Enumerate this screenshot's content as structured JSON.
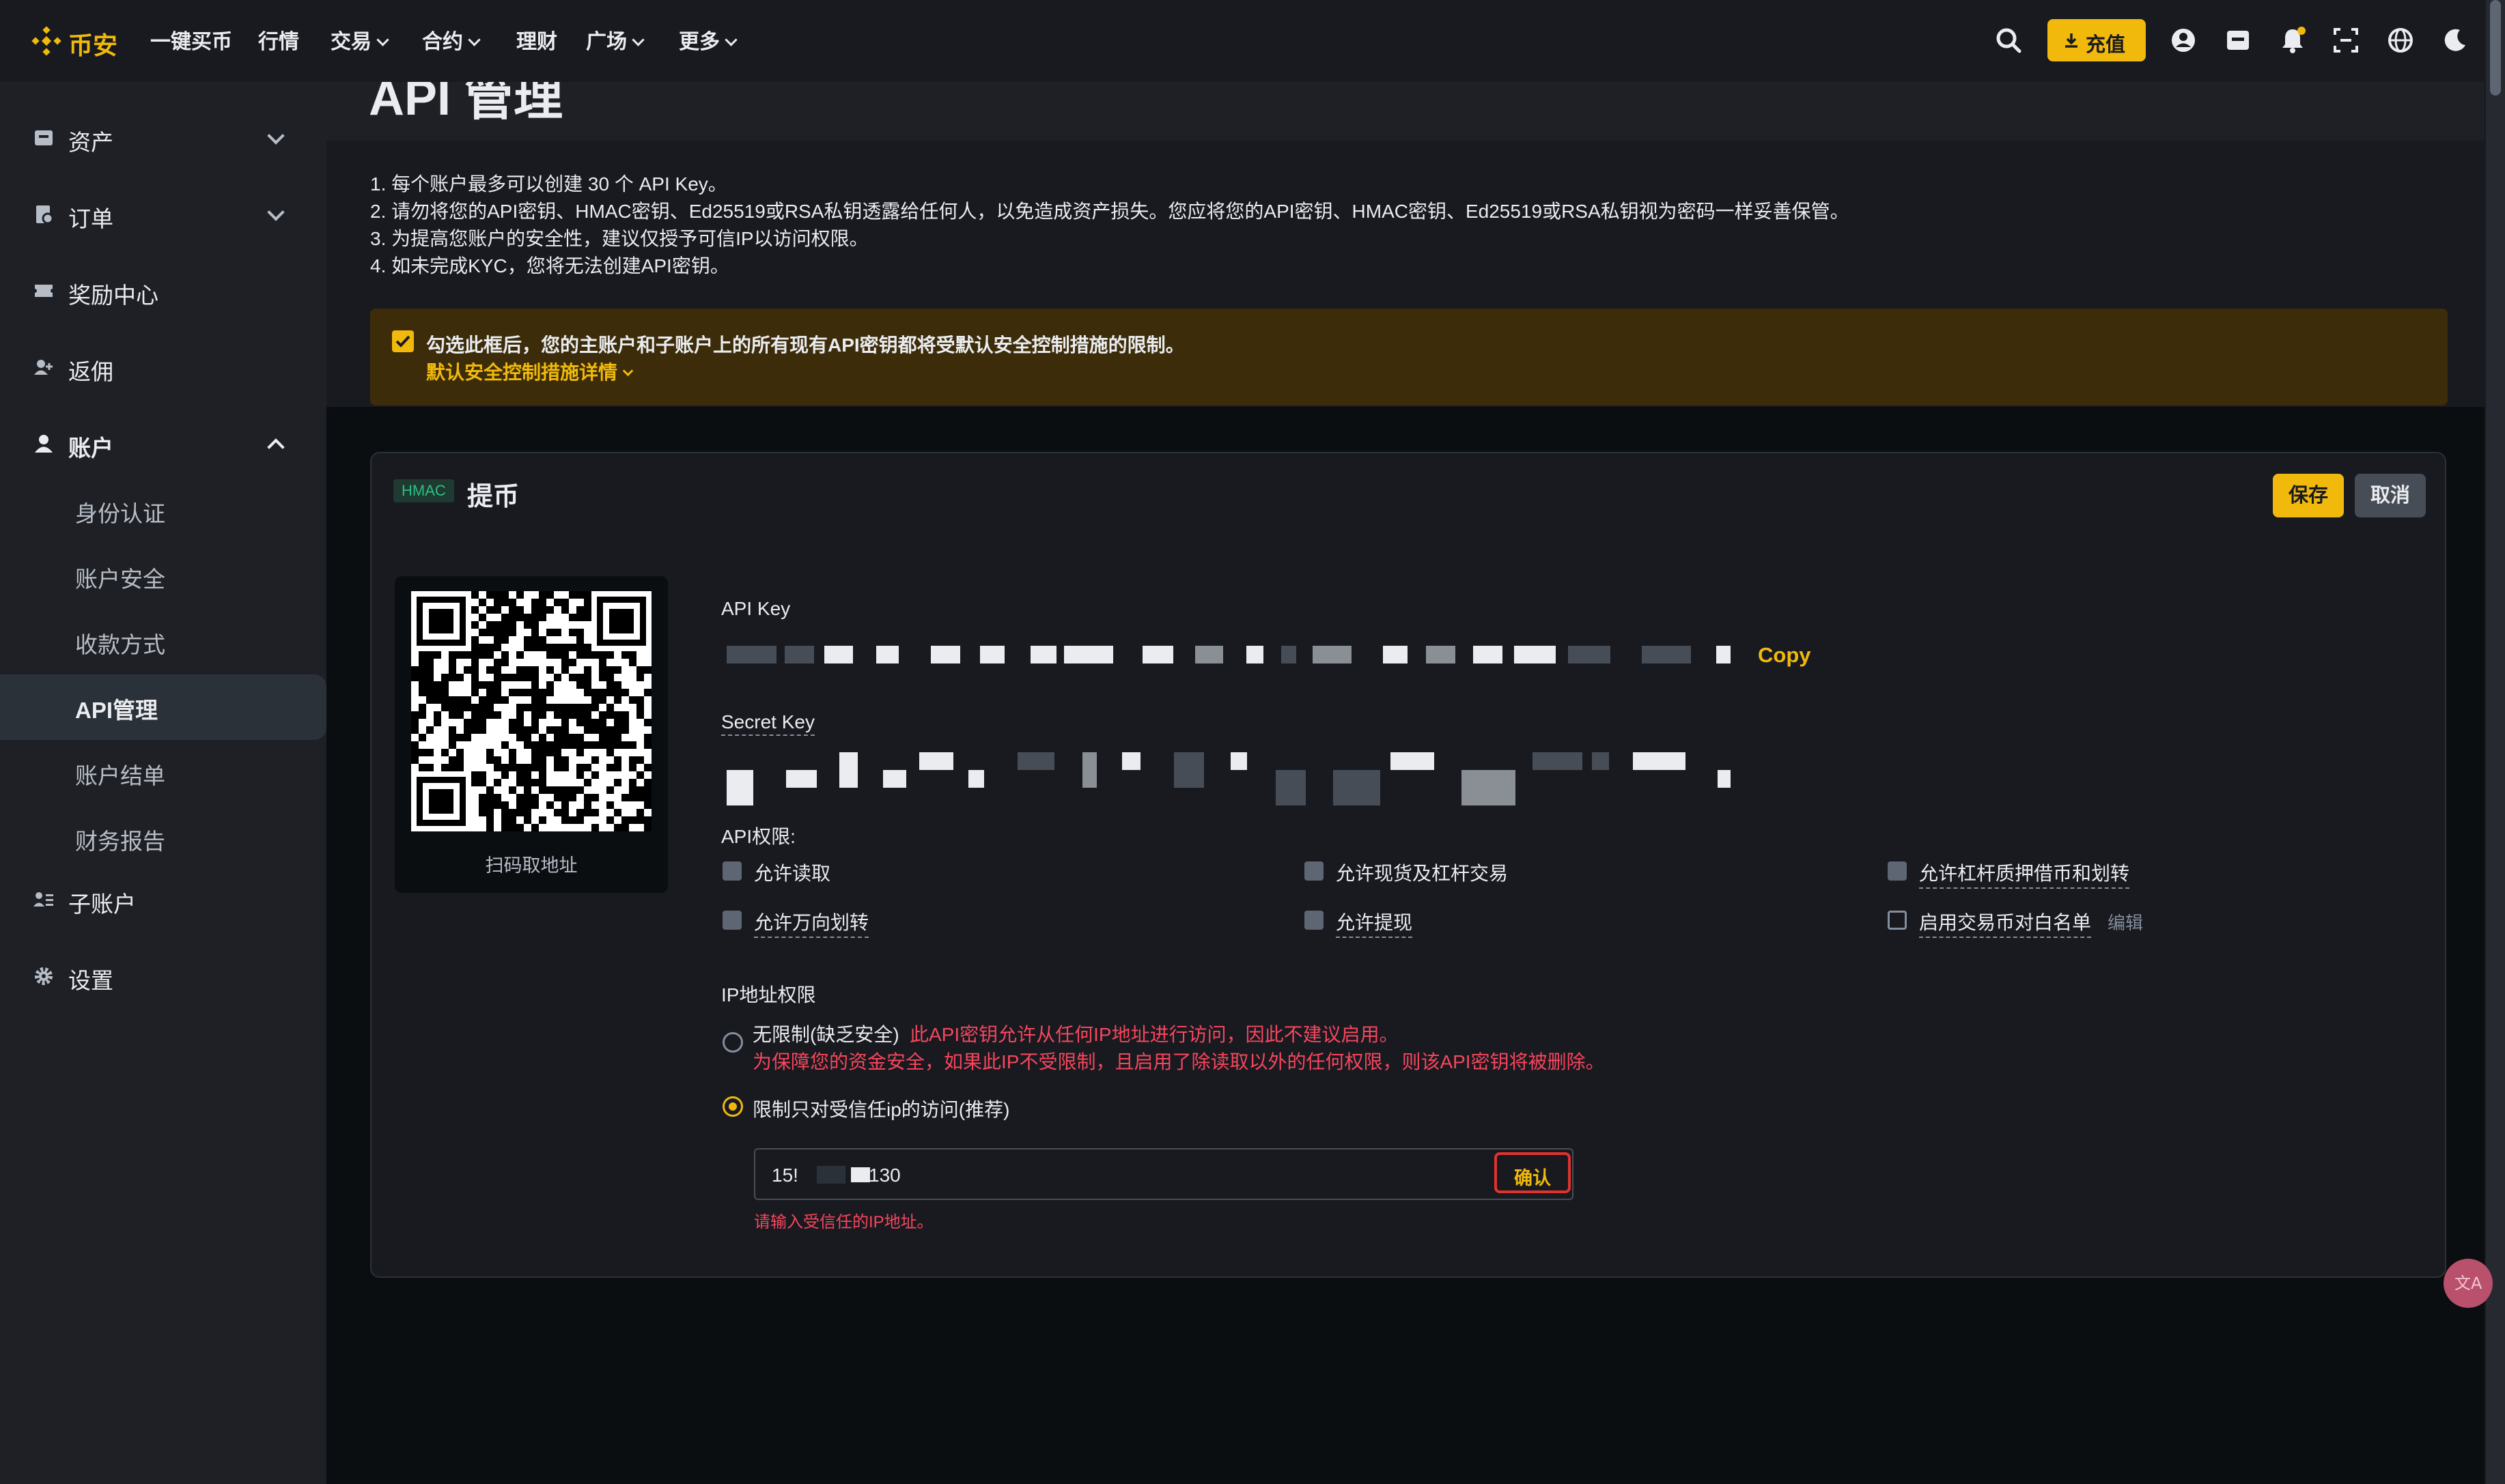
{
  "brand": {
    "name": "币安",
    "accent": "#f0b90b"
  },
  "topnav": {
    "links": [
      "一键买币",
      "行情",
      "交易",
      "合约",
      "理财",
      "广场",
      "更多"
    ],
    "deposit_label": "充值"
  },
  "sidebar": {
    "items": [
      {
        "label": "资产",
        "icon": "wallet-icon"
      },
      {
        "label": "订单",
        "icon": "order-icon"
      },
      {
        "label": "奖励中心",
        "icon": "ticket-icon"
      },
      {
        "label": "返佣",
        "icon": "referral-icon"
      },
      {
        "label": "账户",
        "icon": "user-icon"
      }
    ],
    "account_subitems": [
      "身份认证",
      "账户安全",
      "收款方式",
      "API管理",
      "账户结单",
      "财务报告"
    ],
    "bottom_items": [
      {
        "label": "子账户",
        "icon": "sub-account-icon"
      },
      {
        "label": "设置",
        "icon": "gear-icon"
      }
    ]
  },
  "page": {
    "title": "API 管理",
    "notes": [
      "1. 每个账户最多可以创建 30 个 API Key。",
      "2. 请勿将您的API密钥、HMAC密钥、Ed25519或RSA私钥透露给任何人，以免造成资产损失。您应将您的API密钥、HMAC密钥、Ed25519或RSA私钥视为密码一样妥善保管。",
      "3. 为提高您账户的安全性，建议仅授予可信IP以访问权限。",
      "4. 如未完成KYC，您将无法创建API密钥。"
    ],
    "banner": {
      "text": "勾选此框后，您的主账户和子账户上的所有现有API密钥都将受默认安全控制措施的限制。",
      "link": "默认安全控制措施详情"
    }
  },
  "card": {
    "badge": "HMAC",
    "name": "提币",
    "save_label": "保存",
    "cancel_label": "取消",
    "qr_caption": "扫码取地址",
    "api_key_label": "API Key",
    "copy_label": "Copy",
    "secret_key_label": "Secret Key",
    "permissions_label": "API权限:",
    "permissions": [
      {
        "label": "允许读取",
        "checked": true
      },
      {
        "label": "允许现货及杠杆交易",
        "checked": false
      },
      {
        "label": "允许杠杆质押借币和划转",
        "checked": false
      },
      {
        "label": "允许万向划转",
        "checked": false
      },
      {
        "label": "允许提现",
        "checked": false
      },
      {
        "label": "启用交易币对白名单",
        "checked": false
      }
    ],
    "edit_label": "编辑",
    "ip_label": "IP地址权限",
    "ip_unrestricted": "无限制(缺乏安全)",
    "ip_unrestricted_warning1": "此API密钥允许从任何IP地址进行访问，因此不建议启用。",
    "ip_unrestricted_warning2": "为保障您的资金安全，如果此IP不受限制，且启用了除读取以外的任何权限，则该API密钥将被删除。",
    "ip_restricted": "限制只对受信任ip的访问(推荐)",
    "ip_input_prefix": "15!",
    "ip_input_suffix": "130",
    "confirm_label": "确认",
    "ip_hint": "请输入受信任的IP地址。"
  },
  "colors": {
    "warning": "#f6465d",
    "banner_bg": "#3c2c0a"
  }
}
